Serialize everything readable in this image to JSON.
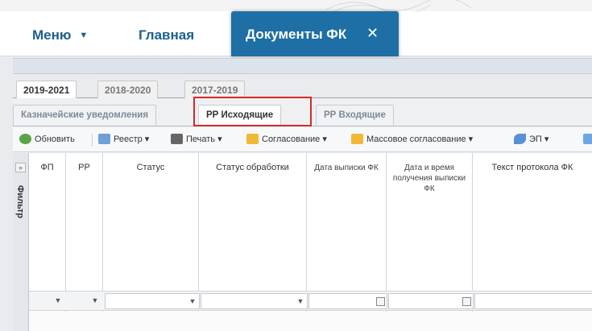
{
  "menubar": {
    "menu_label": "Меню",
    "home_label": "Главная",
    "active_tab_label": "Документы ФК",
    "close_glyph": "✕"
  },
  "year_tabs": [
    "2019-2021",
    "2018-2020",
    "2017-2019"
  ],
  "sub_tabs": [
    "Казначейские уведомления",
    "РР Исходящие",
    "РР Входящие"
  ],
  "toolbar": {
    "refresh": "Обновить",
    "registry": "Реестр ▾",
    "print": "Печать ▾",
    "approval": "Согласование ▾",
    "mass_approval": "Массовое согласование ▾",
    "ep": "ЭП ▾"
  },
  "grid": {
    "side_label": "Фильтр",
    "columns": [
      "ФП",
      "РР",
      "Статус",
      "Статус обработки",
      "Дата выписки ФК",
      "Дата и время получения выписки ФК",
      "Текст протокола ФК"
    ]
  },
  "colors": {
    "menu_text": "#1e5f8e",
    "active_tab_bg": "#1d6fa5",
    "highlight_border": "#d42a2a"
  },
  "icons": [
    "chevron-down-icon",
    "close-icon",
    "refresh-icon",
    "registry-icon",
    "print-icon",
    "folder-icon",
    "signature-icon",
    "calendar-icon"
  ]
}
